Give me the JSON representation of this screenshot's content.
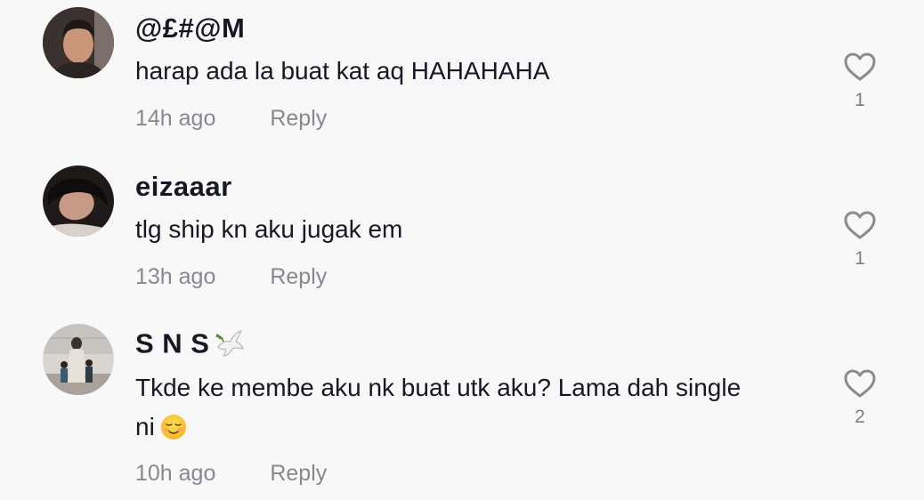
{
  "comments": [
    {
      "username": "@£#@M",
      "text": "harap ada la buat kat aq HAHAHAHA",
      "text_emoji": "",
      "time": "14h ago",
      "reply_label": "Reply",
      "likes": "1",
      "avatar_icon": "avatar-man-photo"
    },
    {
      "username": "eizaaar",
      "text": "tlg ship kn aku jugak em",
      "text_emoji": "",
      "time": "13h ago",
      "reply_label": "Reply",
      "likes": "1",
      "avatar_icon": "avatar-woman-photo"
    },
    {
      "username": "S N S",
      "username_emoji": "🕊️",
      "text": "Tkde ke membe aku nk buat utk aku? Lama dah single ni",
      "text_emoji": "😌",
      "time": "10h ago",
      "reply_label": "Reply",
      "likes": "2",
      "avatar_icon": "avatar-family-photo"
    }
  ],
  "colors": {
    "background": "#f8f8f8",
    "primary_text": "#161823",
    "secondary_text": "rgba(22,24,35,0.5)",
    "heart_outline": "#8a8b91"
  }
}
